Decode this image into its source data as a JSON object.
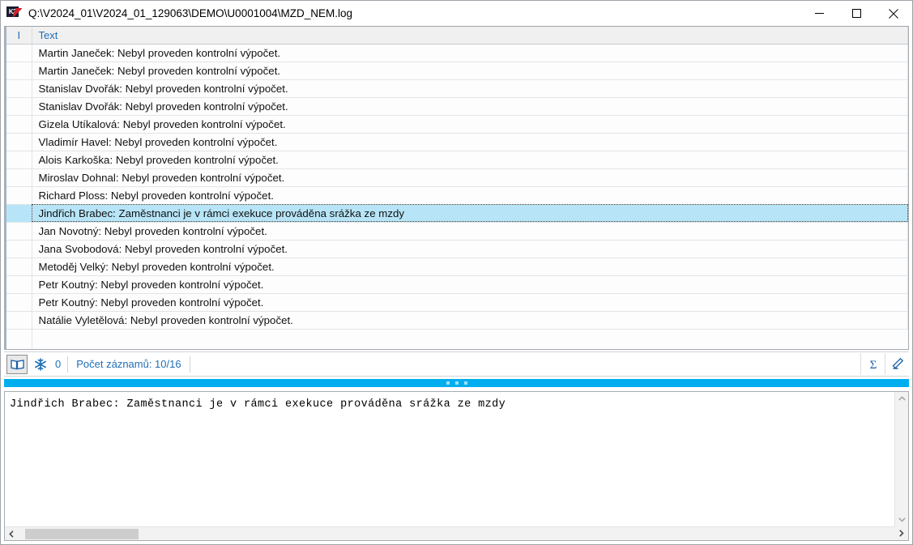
{
  "window": {
    "title": "Q:\\V2024_01\\V2024_01_129063\\DEMO\\U0001004\\MZD_NEM.log",
    "app_icon": "k2-logo-icon",
    "minimize_label": "Minimalizovat",
    "maximize_label": "Maximalizovat",
    "close_label": "Zavřít"
  },
  "grid": {
    "columns": [
      {
        "key": "indicator",
        "label": "I"
      },
      {
        "key": "text",
        "label": "Text"
      }
    ],
    "rows": [
      {
        "indicator": "",
        "text": "Martin Janeček: Nebyl proveden kontrolní výpočet.",
        "selected": false
      },
      {
        "indicator": "",
        "text": "Martin Janeček: Nebyl proveden kontrolní výpočet.",
        "selected": false
      },
      {
        "indicator": "",
        "text": "Stanislav Dvořák: Nebyl proveden kontrolní výpočet.",
        "selected": false
      },
      {
        "indicator": "",
        "text": "Stanislav Dvořák: Nebyl proveden kontrolní výpočet.",
        "selected": false
      },
      {
        "indicator": "",
        "text": "Gizela Utíkalová: Nebyl proveden kontrolní výpočet.",
        "selected": false
      },
      {
        "indicator": "",
        "text": "Vladimír Havel: Nebyl proveden kontrolní výpočet.",
        "selected": false
      },
      {
        "indicator": "",
        "text": "Alois Karkoška: Nebyl proveden kontrolní výpočet.",
        "selected": false
      },
      {
        "indicator": "",
        "text": "Miroslav Dohnal: Nebyl proveden kontrolní výpočet.",
        "selected": false
      },
      {
        "indicator": "",
        "text": "Richard Ploss: Nebyl proveden kontrolní výpočet.",
        "selected": false
      },
      {
        "indicator": "",
        "text": "Jindřich Brabec: Zaměstnanci je v rámci exekuce prováděna srážka ze mzdy",
        "selected": true
      },
      {
        "indicator": "",
        "text": "Jan Novotný: Nebyl proveden kontrolní výpočet.",
        "selected": false
      },
      {
        "indicator": "",
        "text": "Jana Svobodová: Nebyl proveden kontrolní výpočet.",
        "selected": false
      },
      {
        "indicator": "",
        "text": "Metoděj Velký: Nebyl proveden kontrolní výpočet.",
        "selected": false
      },
      {
        "indicator": "",
        "text": "Petr Koutný: Nebyl proveden kontrolní výpočet.",
        "selected": false
      },
      {
        "indicator": "",
        "text": "Petr Koutný: Nebyl proveden kontrolní výpočet.",
        "selected": false
      },
      {
        "indicator": "",
        "text": "Natálie Vyletělová: Nebyl proveden kontrolní výpočet.",
        "selected": false
      }
    ]
  },
  "statusbar": {
    "book_icon": "open-book-icon",
    "snowflake_icon": "snowflake-icon",
    "snowflake_count": "0",
    "records_label": "Počet záznamů: 10/16",
    "sum_icon": "sigma-sum-icon",
    "edit_icon": "pencil-edit-icon"
  },
  "splitter": {
    "handle_icon": "splitter-grip-icon",
    "color": "#00aeef"
  },
  "detail": {
    "text": "Jindřich Brabec: Zaměstnanci je v rámci exekuce prováděna srážka ze mzdy",
    "scroll_up_icon": "chevron-up-icon",
    "scroll_down_icon": "chevron-down-icon",
    "scroll_left_icon": "chevron-left-icon",
    "scroll_right_icon": "chevron-right-icon"
  },
  "colors": {
    "accent": "#00aeef",
    "header_text": "#1f6fb5",
    "selection": "#b7e5f7"
  }
}
